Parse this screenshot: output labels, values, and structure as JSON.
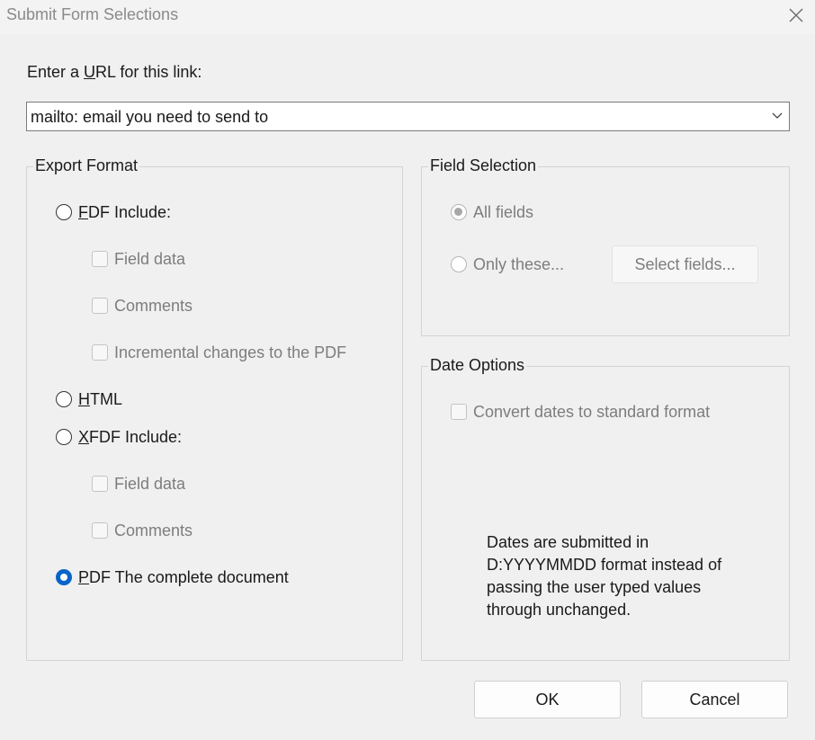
{
  "window": {
    "title": "Submit Form Selections",
    "close_icon": "close-icon"
  },
  "url": {
    "label_pre": "Enter a ",
    "label_accel": "U",
    "label_post": "RL for this link:",
    "value": "mailto: email you need to send to",
    "dropdown_icon": "chevron-down-icon"
  },
  "export_format": {
    "title": "Export Format",
    "fdf": {
      "accel": "F",
      "rest": "DF  Include:",
      "selected": false,
      "options": [
        {
          "label": "Field data",
          "checked": false
        },
        {
          "label": "Comments",
          "checked": false
        },
        {
          "label": "Incremental changes to the PDF",
          "checked": false
        }
      ]
    },
    "html": {
      "accel": "H",
      "rest": "TML",
      "selected": false
    },
    "xfdf": {
      "accel": "X",
      "rest": "FDF  Include:",
      "selected": false,
      "options": [
        {
          "label": "Field data",
          "checked": false
        },
        {
          "label": "Comments",
          "checked": false
        }
      ]
    },
    "pdf": {
      "accel": "P",
      "rest": "DF  The complete document",
      "selected": true
    }
  },
  "field_selection": {
    "title": "Field Selection",
    "all_fields": "All fields",
    "only_these": "Only these...",
    "select_fields_button": "Select fields..."
  },
  "date_options": {
    "title": "Date Options",
    "convert_dates": "Convert dates to standard format",
    "note_lines": [
      "Dates are submitted in",
      "D:YYYYMMDD format instead of",
      "passing the user typed values",
      "through unchanged."
    ]
  },
  "buttons": {
    "ok": "OK",
    "cancel": "Cancel"
  }
}
